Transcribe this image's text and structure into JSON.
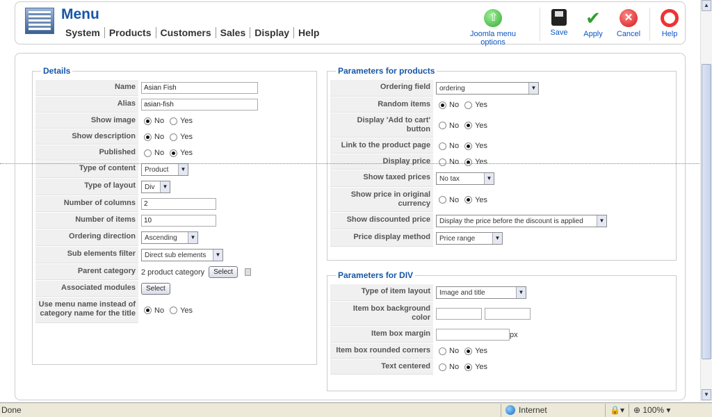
{
  "header": {
    "title": "Menu",
    "menus": [
      "System",
      "Products",
      "Customers",
      "Sales",
      "Display",
      "Help"
    ],
    "tools": {
      "joomla": "Joomla menu options",
      "save": "Save",
      "apply": "Apply",
      "cancel": "Cancel",
      "help": "Help"
    }
  },
  "details": {
    "legend": "Details",
    "name_label": "Name",
    "name_value": "Asian Fish",
    "alias_label": "Alias",
    "alias_value": "asian-fish",
    "show_image_label": "Show image",
    "show_description_label": "Show description",
    "published_label": "Published",
    "type_content_label": "Type of content",
    "type_content_value": "Product",
    "type_layout_label": "Type of layout",
    "type_layout_value": "Div",
    "num_columns_label": "Number of columns",
    "num_columns_value": "2",
    "num_items_label": "Number of items",
    "num_items_value": "10",
    "ordering_direction_label": "Ordering direction",
    "ordering_direction_value": "Ascending",
    "sub_filter_label": "Sub elements filter",
    "sub_filter_value": "Direct sub elements",
    "parent_category_label": "Parent category",
    "parent_category_value": "2 product category",
    "associated_modules_label": "Associated modules",
    "use_menu_name_label": "Use menu name instead of category name for the title",
    "select_label": "Select",
    "no": "No",
    "yes": "Yes"
  },
  "products": {
    "legend": "Parameters for products",
    "ordering_field_label": "Ordering field",
    "ordering_field_value": "ordering",
    "random_items_label": "Random items",
    "add_to_cart_label": "Display 'Add to cart' button",
    "link_product_label": "Link to the product page",
    "display_price_label": "Display price",
    "taxed_prices_label": "Show taxed prices",
    "taxed_prices_value": "No tax",
    "original_currency_label": "Show price in original currency",
    "discounted_price_label": "Show discounted price",
    "discounted_price_value": "Display the price before the discount is applied",
    "price_method_label": "Price display method",
    "price_method_value": "Price range"
  },
  "div": {
    "legend": "Parameters for DIV",
    "item_layout_label": "Type of item layout",
    "item_layout_value": "Image and title",
    "bg_color_label": "Item box background color",
    "margin_label": "Item box margin",
    "margin_unit": "px",
    "rounded_label": "Item box rounded corners",
    "text_centered_label": "Text centered"
  },
  "status": {
    "left": "Done",
    "zone": "Internet",
    "zoom": "100%"
  }
}
